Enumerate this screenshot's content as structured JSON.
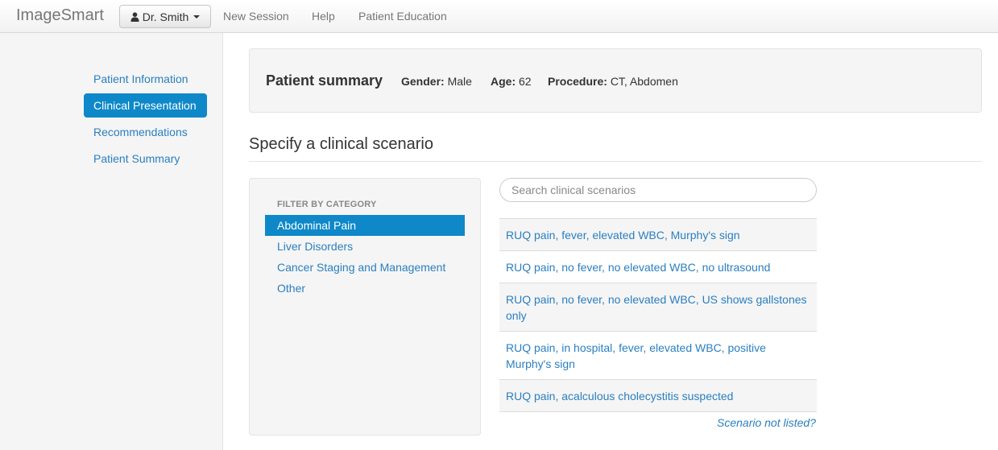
{
  "navbar": {
    "brand": "ImageSmart",
    "user_label": "Dr. Smith",
    "links": [
      "New Session",
      "Help",
      "Patient Education"
    ]
  },
  "sidebar": {
    "items": [
      {
        "label": "Patient Information",
        "active": false
      },
      {
        "label": "Clinical Presentation",
        "active": true
      },
      {
        "label": "Recommendations",
        "active": false
      },
      {
        "label": "Patient Summary",
        "active": false
      }
    ]
  },
  "summary": {
    "title": "Patient summary",
    "gender_label": "Gender:",
    "gender": "Male",
    "age_label": "Age:",
    "age": "62",
    "procedure_label": "Procedure:",
    "procedure": "CT, Abdomen"
  },
  "scenario": {
    "title": "Specify a clinical scenario",
    "filter_heading": "FILTER BY CATEGORY",
    "categories": [
      {
        "label": "Abdominal Pain",
        "active": true
      },
      {
        "label": "Liver Disorders",
        "active": false
      },
      {
        "label": "Cancer Staging and Management",
        "active": false
      },
      {
        "label": "Other",
        "active": false
      }
    ],
    "search_placeholder": "Search clinical scenarios",
    "items": [
      "RUQ pain, fever, elevated WBC, Murphy's sign",
      "RUQ pain, no fever, no elevated WBC, no ultrasound",
      "RUQ pain, no fever, no elevated WBC, US shows gallstones only",
      "RUQ pain, in hospital, fever, elevated WBC, positive Murphy's sign",
      "RUQ pain, acalculous cholecystitis suspected"
    ],
    "not_listed": "Scenario not listed?"
  },
  "colors": {
    "accent": "#0e88c8",
    "link": "#2a7fc1"
  },
  "icons": {
    "user": "user-icon",
    "caret": "caret-down-icon"
  }
}
